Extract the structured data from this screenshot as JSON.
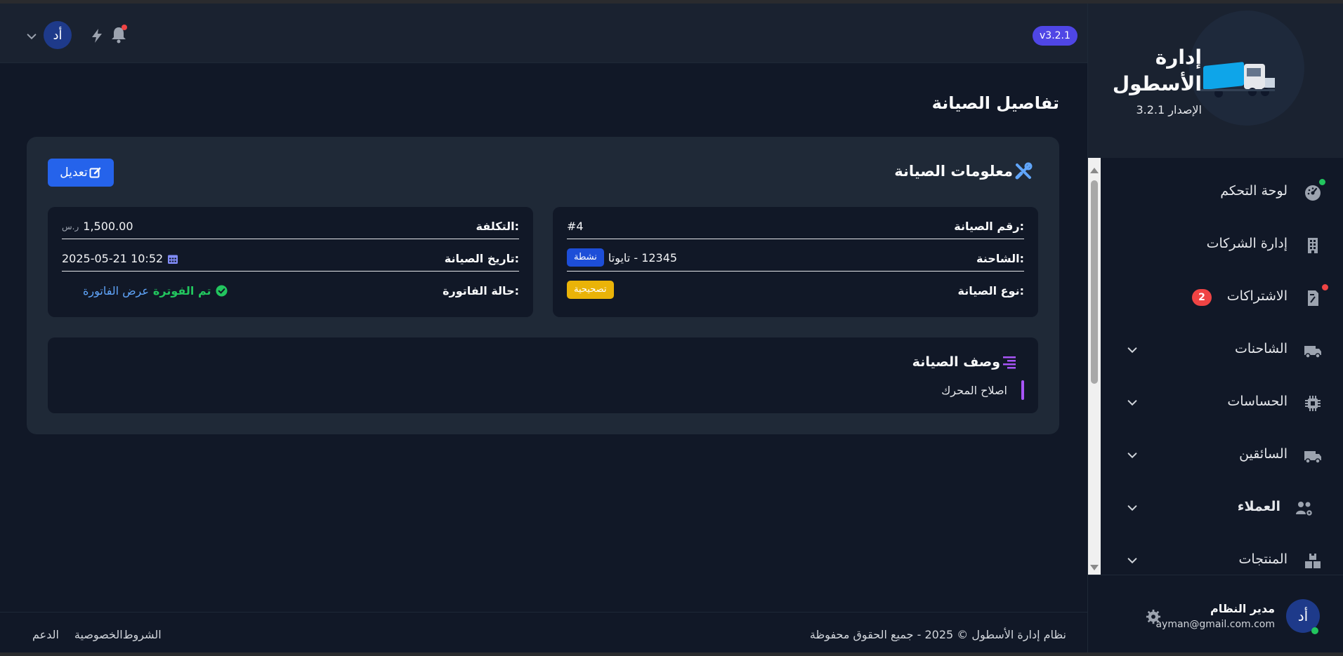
{
  "header": {
    "version_badge": "v3.2.1",
    "user_initials": "أد"
  },
  "sidebar": {
    "brand_title": "إدارة الأسطول",
    "brand_version": "الإصدار 3.2.1",
    "items": [
      {
        "label": "لوحة التحكم",
        "icon": "dashboard-gauge-icon"
      },
      {
        "label": "إدارة الشركات",
        "icon": "building-icon"
      },
      {
        "label": "الاشتراكات",
        "icon": "receipt-icon",
        "badge": "2"
      },
      {
        "label": "الشاحنات",
        "icon": "truck-icon"
      },
      {
        "label": "الحساسات",
        "icon": "chip-icon"
      },
      {
        "label": "السائقين",
        "icon": "truck-icon"
      },
      {
        "label": "العملاء",
        "icon": "users-gear-icon"
      },
      {
        "label": "المنتجات",
        "icon": "boxes-icon"
      }
    ],
    "user": {
      "initials": "أد",
      "name": "مدير النظام",
      "email": "ayman@gmail.com.com"
    }
  },
  "main": {
    "page_title": "تفاصيل الصيانة",
    "section_title": "معلومات الصيانة",
    "edit_label": "تعديل",
    "right_box": {
      "maintenance_no_label": "رقم الصيانة:",
      "maintenance_no_value": "#4",
      "truck_label": "الشاحنة:",
      "truck_value": "12345 - تايوتا",
      "truck_status": "نشطة",
      "type_label": "نوع الصيانة:",
      "type_value": "تصحيحية"
    },
    "left_box": {
      "cost_label": "التكلفة:",
      "cost_value": "1,500.00",
      "cost_currency": "ر.س",
      "date_label": "تاريخ الصيانة:",
      "date_value": "2025-05-21 10:52",
      "invoice_label": "حالة الفاتورة:",
      "invoice_status": "تم الفوترة",
      "invoice_link": "عرض الفاتورة"
    },
    "description_title": "وصف الصيانة",
    "description_text": "اصلاح المحرك"
  },
  "footer": {
    "copyright": "نظام إدارة الأسطول © 2025 - جميع الحقوق محفوظة",
    "links": [
      "الشروط",
      "الخصوصية",
      "الدعم"
    ]
  },
  "colors": {
    "background": "#111827",
    "card": "#1f2937",
    "primary": "#2563eb",
    "version_badge": "#4f46e5",
    "warning": "#eab308",
    "success": "#22c55e",
    "danger": "#ef4444",
    "accent_purple": "#a855f7"
  }
}
